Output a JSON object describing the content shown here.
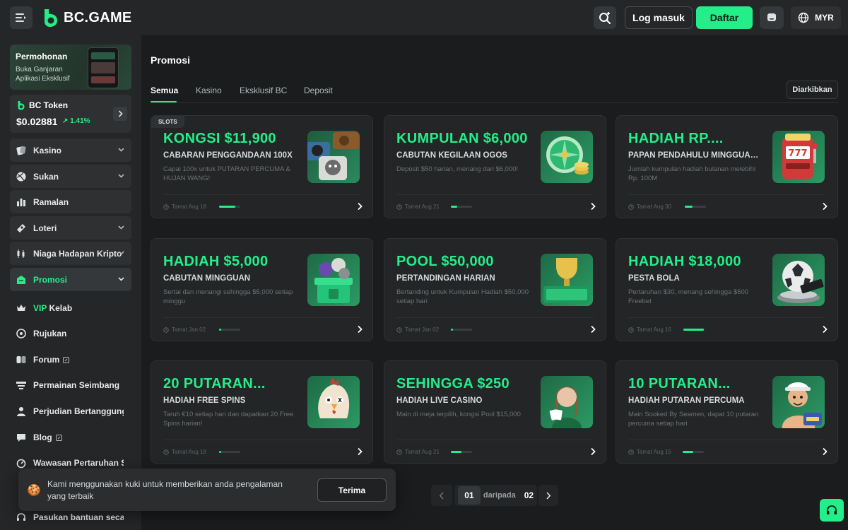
{
  "header": {
    "brand": "BC.GAME",
    "login_label": "Log masuk",
    "signup_label": "Daftar",
    "currency": "MYR"
  },
  "sidebar": {
    "app_promo": {
      "title": "Permohonan",
      "subtitle": "Buka Ganjaran Aplikasi Eksklusif"
    },
    "token": {
      "name": "BC Token",
      "price": "$0.02881",
      "change": "1.41%"
    },
    "items": [
      {
        "label": "Kasino",
        "icon": "casino-icon"
      },
      {
        "label": "Sukan",
        "icon": "sports-icon"
      },
      {
        "label": "Ramalan",
        "icon": "prediction-icon"
      },
      {
        "label": "Loteri",
        "icon": "lottery-icon"
      },
      {
        "label": "Niaga Hadapan Kripto",
        "icon": "futures-icon"
      },
      {
        "label": "Promosi",
        "icon": "promo-icon"
      },
      {
        "label_accent": "VIP",
        "label": "Kelab",
        "icon": "vip-icon"
      },
      {
        "label": "Rujukan",
        "icon": "referral-icon"
      },
      {
        "label": "Forum",
        "icon": "forum-icon"
      },
      {
        "label": "Permainan Seimbang",
        "icon": "fair-icon"
      },
      {
        "label": "Perjudian Bertanggungjawab",
        "icon": "responsible-icon"
      },
      {
        "label": "Blog",
        "icon": "blog-icon"
      },
      {
        "label": "Wawasan Pertaruhan Sukan",
        "icon": "insight-icon"
      },
      {
        "label": "Pasukan bantuan secara langsung",
        "icon": "support-icon"
      }
    ]
  },
  "main": {
    "title": "Promosi",
    "tabs": [
      "Semua",
      "Kasino",
      "Eksklusif BC",
      "Deposit"
    ],
    "archive_label": "Diarkibkan",
    "cards": [
      {
        "badge": "SLOTS",
        "title": "KONGSI $11,900",
        "subtitle": "CABARAN PENGGANDAAN 100X",
        "desc": "Capai 100x untuk PUTARAN PERCUMA & HUJAN WANG!",
        "footer": "Tamat Aug 18",
        "progress": 0.75
      },
      {
        "title": "KUMPULAN $6,000",
        "subtitle": "CABUTAN KEGILAAN OGOS",
        "desc": "Deposit $50 harian, menang dari $6,000!",
        "footer": "Tamat Aug 21",
        "progress": 0.3
      },
      {
        "title": "HADIAH RP....",
        "subtitle": "PAPAN PENDAHULU MINGGUAN...",
        "desc": "Jumlah kumpulan hadiah bulanan melebihi Rp. 100M",
        "footer": "Tamat Aug 30",
        "progress": 0.35
      },
      {
        "title": "HADIAH $5,000",
        "subtitle": "CABUTAN MINGGUAN",
        "desc": "Sertai dan menangi sehingga $5,000 setiap minggu",
        "footer": "Tamat Jan 02",
        "progress": 0.1
      },
      {
        "title": "POOL $50,000",
        "subtitle": "PERTANDINGAN HARIAN",
        "desc": "Bertanding untuk Kumpulan Hadiah $50,000 setiap hari",
        "footer": "Tamat Jan 02",
        "progress": 0.1
      },
      {
        "title": "HADIAH $18,000",
        "subtitle": "PESTA BOLA",
        "desc": "Pertaruhan $30, menang sehingga $500 Freebet",
        "footer": "Tamat Aug 16",
        "progress": 0.95
      },
      {
        "title": "20 PUTARAN...",
        "subtitle": "HADIAH FREE SPINS",
        "desc": "Taruh €10 setiap hari dan dapatkan 20 Free Spins harian!",
        "footer": "Tamat Aug 18",
        "progress": 0.1
      },
      {
        "title": "SEHINGGA $250",
        "subtitle": "HADIAH LIVE CASINO",
        "desc": "Main di meja terpilih, kongsi Pool $15,000",
        "footer": "Tamat Aug 21",
        "progress": 0.5
      },
      {
        "title": "10 PUTARAN...",
        "subtitle": "HADIAH PUTARAN PERCUMA",
        "desc": "Main Sooked By Seamen, dapat 10 putaran percuma setiap hari",
        "footer": "Tamat Aug 15",
        "progress": 0.5
      }
    ],
    "pagination": {
      "current": "01",
      "of_label": "daripada",
      "total": "02"
    }
  },
  "cookie": {
    "message": "Kami menggunakan kuki untuk memberikan anda pengalaman yang terbaik",
    "accept_label": "Terima"
  },
  "colors": {
    "accent": "#24ee89",
    "background": "#1a1c1d",
    "panel": "#242627",
    "card": "#232526"
  }
}
